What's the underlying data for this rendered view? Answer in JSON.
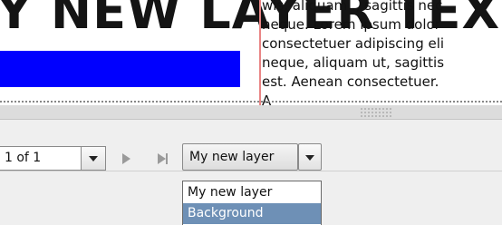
{
  "canvas": {
    "heading_text": "Y NEW LAYER TEXT",
    "lorem_lines": [
      "wis. aliquam ., sagittis nec",
      "neque. Lorem ipsum dolor",
      "consectetuer adipiscing eli",
      "neque, aliquam ut, sagittis",
      "est. Aenean consectetuer.",
      "A"
    ],
    "colors": {
      "blue_bar": "#0000ff",
      "red_guide": "#e98585"
    }
  },
  "toolbar": {
    "page_indicator": "1 of 1",
    "icons": [
      "chevron-down-icon",
      "next-page-icon",
      "last-page-icon",
      "chevron-down-icon"
    ],
    "layer_select": {
      "selected": "My new layer",
      "options": [
        "My new layer",
        "Background"
      ],
      "highlighted": "Background"
    }
  },
  "colors": {
    "highlight": "#6e90b6",
    "toolbar_bg": "#efefef"
  }
}
